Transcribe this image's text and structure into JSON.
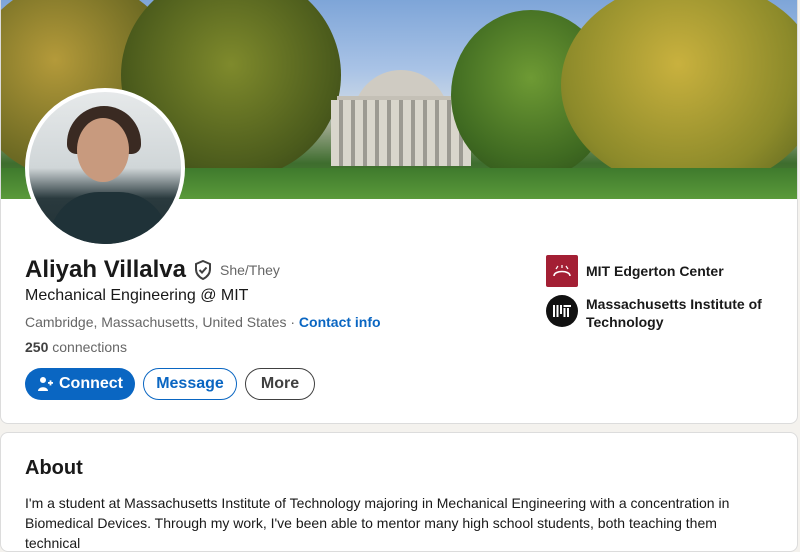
{
  "profile": {
    "name": "Aliyah Villalva",
    "pronouns": "She/They",
    "headline": "Mechanical Engineering @ MIT",
    "location": "Cambridge, Massachusetts, United States",
    "location_separator": "·",
    "contact_info": "Contact info",
    "connections_count": "250",
    "connections_label": "connections"
  },
  "actions": {
    "connect": "Connect",
    "message": "Message",
    "more": "More"
  },
  "affiliations": [
    {
      "name": "MIT Edgerton Center",
      "logo_icon": "edgerton-logo-icon"
    },
    {
      "name": "Massachusetts Institute of Technology",
      "logo_icon": "mit-logo-icon"
    }
  ],
  "about": {
    "title": "About",
    "text": "I'm a student at Massachusetts Institute of Technology majoring in Mechanical Engineering with a concentration in Biomedical Devices. Through my work, I've been able to mentor many high school students, both teaching them technical"
  },
  "colors": {
    "brand_blue": "#0a66c2",
    "mit_red": "#a31f34",
    "page_bg": "#f4f2ee"
  }
}
